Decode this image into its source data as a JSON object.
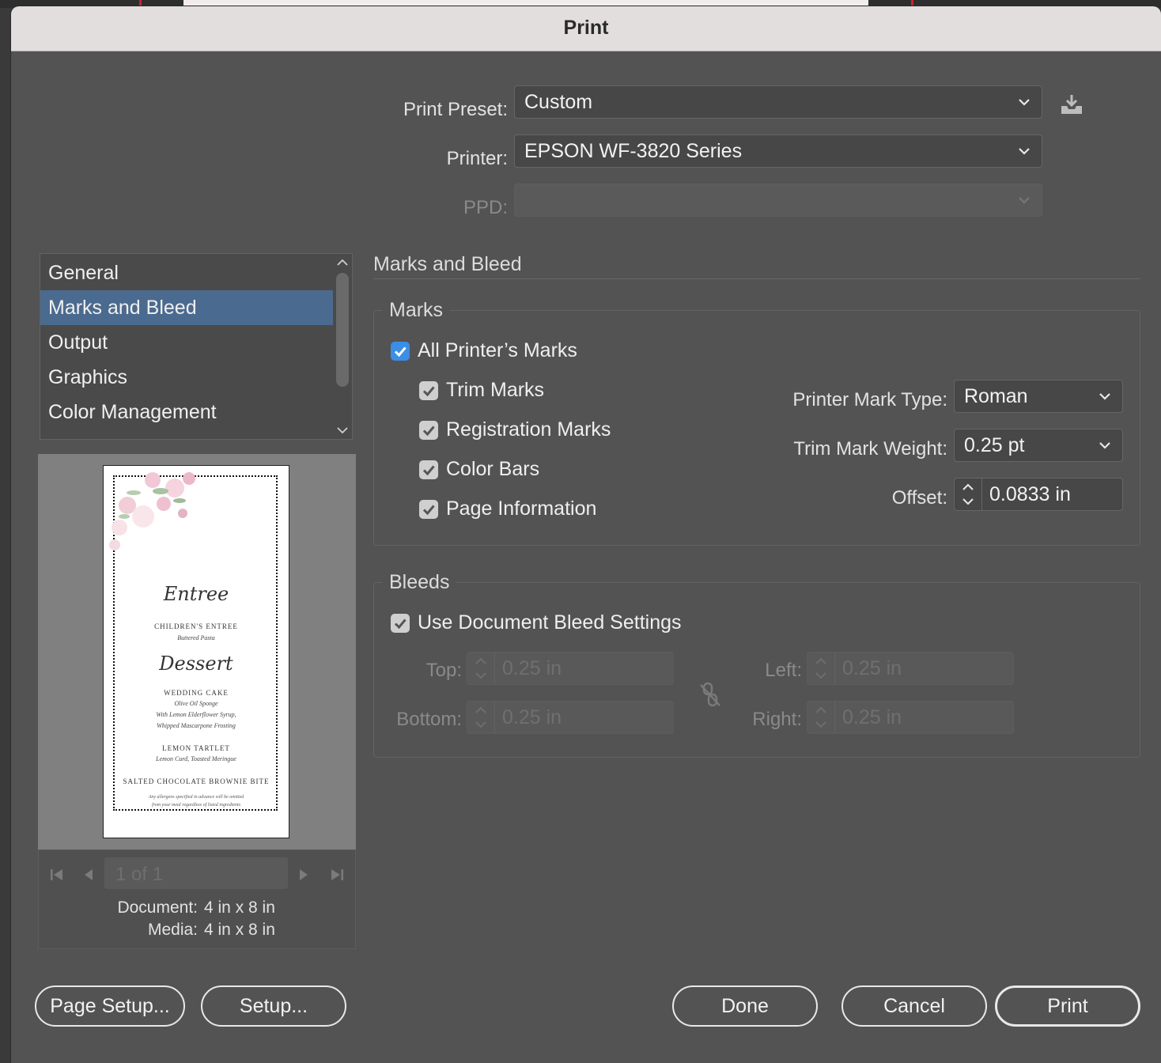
{
  "window": {
    "title": "Print"
  },
  "top": {
    "preset_label": "Print Preset:",
    "preset_value": "Custom",
    "printer_label": "Printer:",
    "printer_value": "EPSON WF-3820 Series",
    "ppd_label": "PPD:",
    "ppd_value": ""
  },
  "sidebar": {
    "items": [
      {
        "label": "General"
      },
      {
        "label": "Marks and Bleed"
      },
      {
        "label": "Output"
      },
      {
        "label": "Graphics"
      },
      {
        "label": "Color Management"
      }
    ],
    "selected": "Marks and Bleed"
  },
  "preview": {
    "menu": {
      "entree_script": "Entree",
      "kids_title": "CHILDREN'S ENTREE",
      "kids_desc": "Buttered Pasta",
      "dessert_script": "Dessert",
      "cake_title": "WEDDING CAKE",
      "cake_desc1": "Olive Oil Sponge",
      "cake_desc2": "With Lemon Elderflower Syrup,",
      "cake_desc3": "Whipped Mascarpone Frosting",
      "tart_title": "LEMON TARTLET",
      "tart_desc": "Lemon Curd, Toasted Meringue",
      "brownie_title": "SALTED CHOCOLATE BROWNIE BITE",
      "note1": "Any allergens specified in advance will be omitted",
      "note2": "from your meal regardless of listed ingredients"
    },
    "page_nav": "1 of 1",
    "document_label": "Document:",
    "document_value": "4 in x 8 in",
    "media_label": "Media:",
    "media_value": "4 in x 8 in"
  },
  "marks_bleed": {
    "section_title": "Marks and Bleed",
    "marks_group": "Marks",
    "all_marks": {
      "label": "All Printer’s Marks",
      "checked": true
    },
    "trim_marks": {
      "label": "Trim Marks",
      "checked": true
    },
    "registration_marks": {
      "label": "Registration Marks",
      "checked": true
    },
    "color_bars": {
      "label": "Color Bars",
      "checked": true
    },
    "page_information": {
      "label": "Page Information",
      "checked": true
    },
    "mark_type_label": "Printer Mark Type:",
    "mark_type_value": "Roman",
    "trim_weight_label": "Trim Mark Weight:",
    "trim_weight_value": "0.25 pt",
    "offset_label": "Offset:",
    "offset_value": "0.0833 in",
    "bleeds_group": "Bleeds",
    "use_doc_bleed": {
      "label": "Use Document Bleed Settings",
      "checked": true
    },
    "top_label": "Top:",
    "top_value": "0.25 in",
    "bottom_label": "Bottom:",
    "bottom_value": "0.25 in",
    "left_label": "Left:",
    "left_value": "0.25 in",
    "right_label": "Right:",
    "right_value": "0.25 in"
  },
  "buttons": {
    "page_setup": "Page Setup...",
    "setup": "Setup...",
    "done": "Done",
    "cancel": "Cancel",
    "print": "Print"
  },
  "colors": {
    "dialog_bg": "#535353",
    "selection": "#4b6a8f",
    "checkbox_blue": "#3a8ee6"
  }
}
